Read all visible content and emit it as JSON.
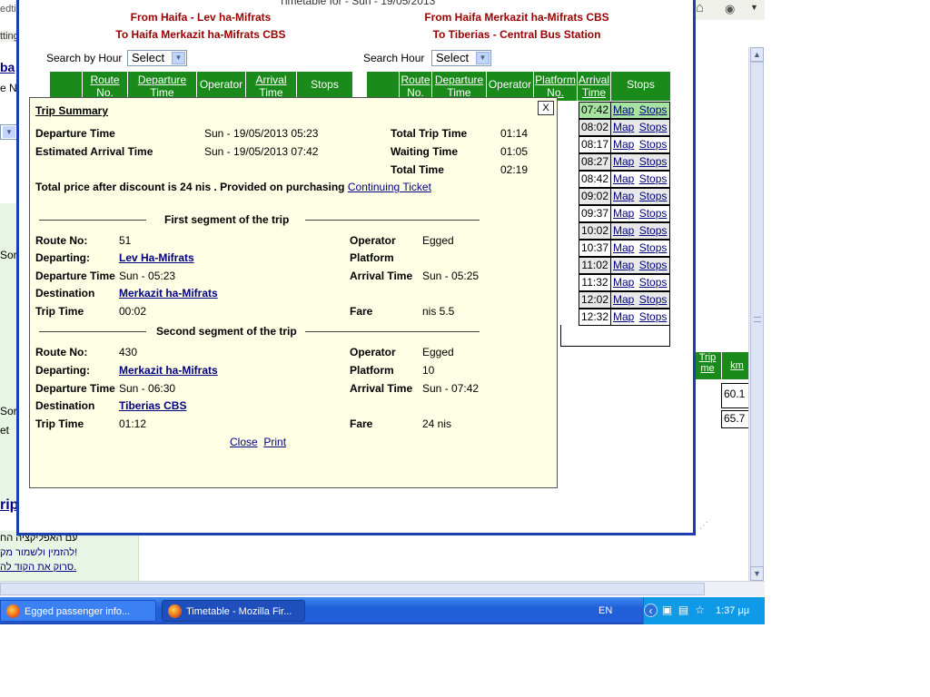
{
  "popup": {
    "title": "Timetable for - Sun - 19/05/2013",
    "left_route": {
      "from": "From Haifa - Lev ha-Mifrats",
      "to": "To Haifa Merkazit ha-Mifrats CBS"
    },
    "right_route": {
      "from": "From Haifa Merkazit ha-Mifrats CBS",
      "to": "To Tiberias - Central Bus Station"
    },
    "search_label": "Search by Hour",
    "search_label_right": "Search Hour",
    "select_value": "Select",
    "left_table_headers": [
      "",
      "Route No.",
      "Departure Time",
      "Operator",
      "Arrival Time",
      "Stops"
    ],
    "right_table_headers": [
      "",
      "Route No.",
      "Departure Time",
      "Operator",
      "Platform No.",
      "Arrival Time",
      "Stops"
    ],
    "map_label": "Map",
    "stops_label": "Stops",
    "right_rows": [
      {
        "arrival": "07:42"
      },
      {
        "arrival": "08:02"
      },
      {
        "arrival": "08:17"
      },
      {
        "arrival": "08:27"
      },
      {
        "arrival": "08:42"
      },
      {
        "arrival": "09:02"
      },
      {
        "arrival": "09:37"
      },
      {
        "arrival": "10:02"
      },
      {
        "arrival": "10:37"
      },
      {
        "arrival": "11:02"
      },
      {
        "arrival": "11:32"
      },
      {
        "arrival": "12:02"
      },
      {
        "arrival": "12:32"
      }
    ]
  },
  "dialog": {
    "title": "Trip Summary",
    "close_x": "X",
    "departure_time_label": "Departure Time",
    "departure_time_value": "Sun - 19/05/2013 05:23",
    "estimated_arrival_label": "Estimated Arrival Time",
    "estimated_arrival_value": "Sun - 19/05/2013 07:42",
    "total_trip_time_label": "Total Trip Time",
    "total_trip_time_value": "01:14",
    "waiting_time_label": "Waiting Time",
    "waiting_time_value": "01:05",
    "total_time_label": "Total Time",
    "total_time_value": "02:19",
    "price_text": "Total price after discount is 24 nis . Provided on purchasing",
    "price_link": "Continuing Ticket",
    "segments": [
      {
        "heading": "First segment of the trip",
        "route_no_label": "Route No:",
        "route_no": "51",
        "operator_label": "Operator",
        "operator": "Egged",
        "departing_label": "Departing:",
        "departing": "Lev Ha-Mifrats",
        "platform_label": "Platform",
        "platform": "",
        "departure_time_label": "Departure Time",
        "departure_time": "Sun - 05:23",
        "arrival_time_label": "Arrival Time",
        "arrival_time": "Sun - 05:25",
        "destination_label": "Destination",
        "destination": "Merkazit ha-Mifrats",
        "trip_time_label": "Trip Time",
        "trip_time": "00:02",
        "fare_label": "Fare",
        "fare": "nis 5.5"
      },
      {
        "heading": "Second segment of the trip",
        "route_no_label": "Route No:",
        "route_no": "430",
        "operator_label": "Operator",
        "operator": "Egged",
        "departing_label": "Departing:",
        "departing": "Merkazit ha-Mifrats",
        "platform_label": "Platform",
        "platform": "10",
        "departure_time_label": "Departure Time",
        "departure_time": "Sun - 06:30",
        "arrival_time_label": "Arrival Time",
        "arrival_time": "Sun - 07:42",
        "destination_label": "Destination",
        "destination": "Tiberias CBS",
        "trip_time_label": "Trip Time",
        "trip_time": "01:12",
        "fare_label": "Fare",
        "fare": "24 nis"
      }
    ],
    "close_link": "Close",
    "print_link": "Print"
  },
  "background": {
    "left_fragments": [
      "edti",
      "tting",
      "ba",
      "e N",
      "Sor",
      "Sor",
      "et",
      "rip"
    ],
    "hebrew_lines": [
      "עם האפליקציה הח",
      "להזמין ולשמור מק!",
      "סרוק את הקוד לה."
    ],
    "right_headers": [
      "Trip me",
      "km"
    ],
    "right_values": [
      "60.1",
      "65.7"
    ]
  },
  "taskbar": {
    "tasks": [
      "Egged passenger info...",
      "Timetable - Mozilla Fir..."
    ],
    "language": "EN",
    "clock": "1:37 μμ"
  },
  "colors": {
    "header_green": "#1a8a1a",
    "route_red": "#990000",
    "dialog_bg": "#ffffe6",
    "window_border": "#1a3fb0",
    "highlight_row": "#a6e3a0"
  }
}
